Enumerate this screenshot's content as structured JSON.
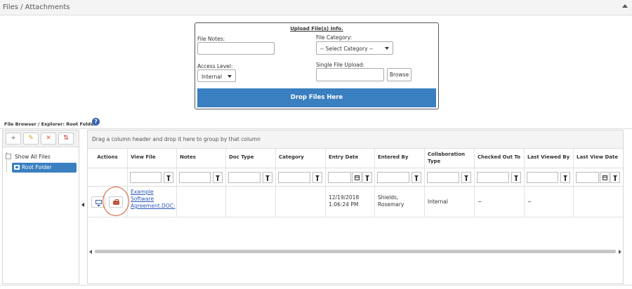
{
  "panel": {
    "title": "Files / Attachments"
  },
  "upload": {
    "title": "Upload File(s) Info.",
    "file_notes_label": "File Notes:",
    "file_category_label": "File Category:",
    "category_selected": "-- Select Category --",
    "access_level_label": "Access Level:",
    "access_level_selected": "Internal",
    "single_file_label": "Single File Upload:",
    "browse_label": "Browse",
    "drop_label": "Drop Files Here"
  },
  "browser": {
    "label": "File Browser / Explorer:  Root Folder",
    "help_glyph": "?",
    "toolbar": {
      "add_glyph": "+",
      "edit_glyph": "✎",
      "delete_glyph": "✕",
      "sort_glyph": "⇅"
    },
    "tree": {
      "show_all": "Show All Files",
      "root_folder": "Root Folder"
    }
  },
  "grid": {
    "group_hint": "Drag a column header and drop it here to group by that column",
    "columns": [
      "Actions",
      "View File",
      "Notes",
      "Doc Type",
      "Category",
      "Entry Date",
      "Entered By",
      "Collaboration Type",
      "Checked Out To",
      "Last Viewed By",
      "Last View Date"
    ],
    "rows": [
      {
        "view_file": "Example Software Agreement.DOC:",
        "notes": "",
        "doc_type": "",
        "category": "",
        "entry_date": "12/19/2018 1:06:24 PM",
        "entered_by": "Shields, Rosemary",
        "collaboration_type": "Internal",
        "checked_out_to": "~",
        "last_viewed_by": "~",
        "last_view_date": ""
      }
    ]
  },
  "colors": {
    "primary": "#3a7fc0",
    "highlight": "#d2592e",
    "link": "#2a59b8"
  }
}
